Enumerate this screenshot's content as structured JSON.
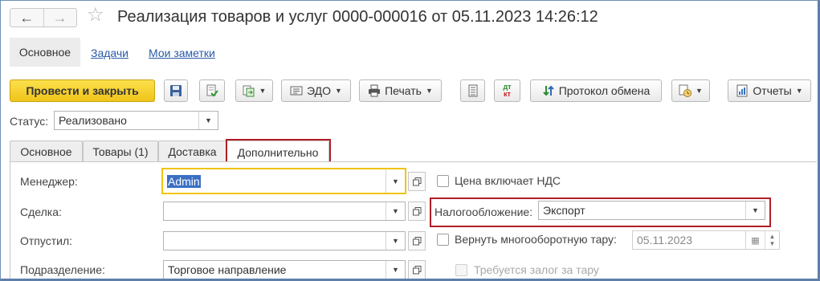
{
  "window": {
    "title": "Реализация товаров и услуг 0000-000016 от 05.11.2023 14:26:12"
  },
  "nav": {
    "back_icon": "arrow-left-icon",
    "forward_icon": "arrow-right-icon",
    "favorite_icon": "star-icon"
  },
  "top_tabs": {
    "main": "Основное",
    "tasks": "Задачи",
    "notes": "Мои заметки"
  },
  "toolbar": {
    "post_close": "Провести и закрыть",
    "edo": "ЭДО",
    "print": "Печать",
    "dt_kt_top": "дт",
    "dt_kt_bottom": "кт",
    "exchange_log": "Протокол обмена",
    "reports": "Отчеты"
  },
  "status": {
    "label": "Статус:",
    "value": "Реализовано"
  },
  "form_tabs": [
    {
      "label": "Основное"
    },
    {
      "label": "Товары (1)"
    },
    {
      "label": "Доставка"
    },
    {
      "label": "Дополнительно"
    }
  ],
  "fields": {
    "manager_label": "Менеджер:",
    "manager_value": "Admin",
    "deal_label": "Сделка:",
    "deal_value": "",
    "released_label": "Отпустил:",
    "released_value": "",
    "division_label": "Подразделение:",
    "division_value": "Торговое направление",
    "price_vat_label": "Цена включает НДС",
    "price_vat_checked": false,
    "taxation_label": "Налогообложение:",
    "taxation_value": "Экспорт",
    "return_tare_label": "Вернуть многооборотную тару:",
    "return_tare_checked": false,
    "return_tare_date": "05.11.2023",
    "deposit_label": "Требуется залог за тару",
    "deposit_checked": false
  },
  "colors": {
    "accent_yellow": "#f0c419",
    "link_blue": "#2a5aa8",
    "highlight_red": "#b01e28",
    "selection_blue": "#3a6fc5"
  }
}
